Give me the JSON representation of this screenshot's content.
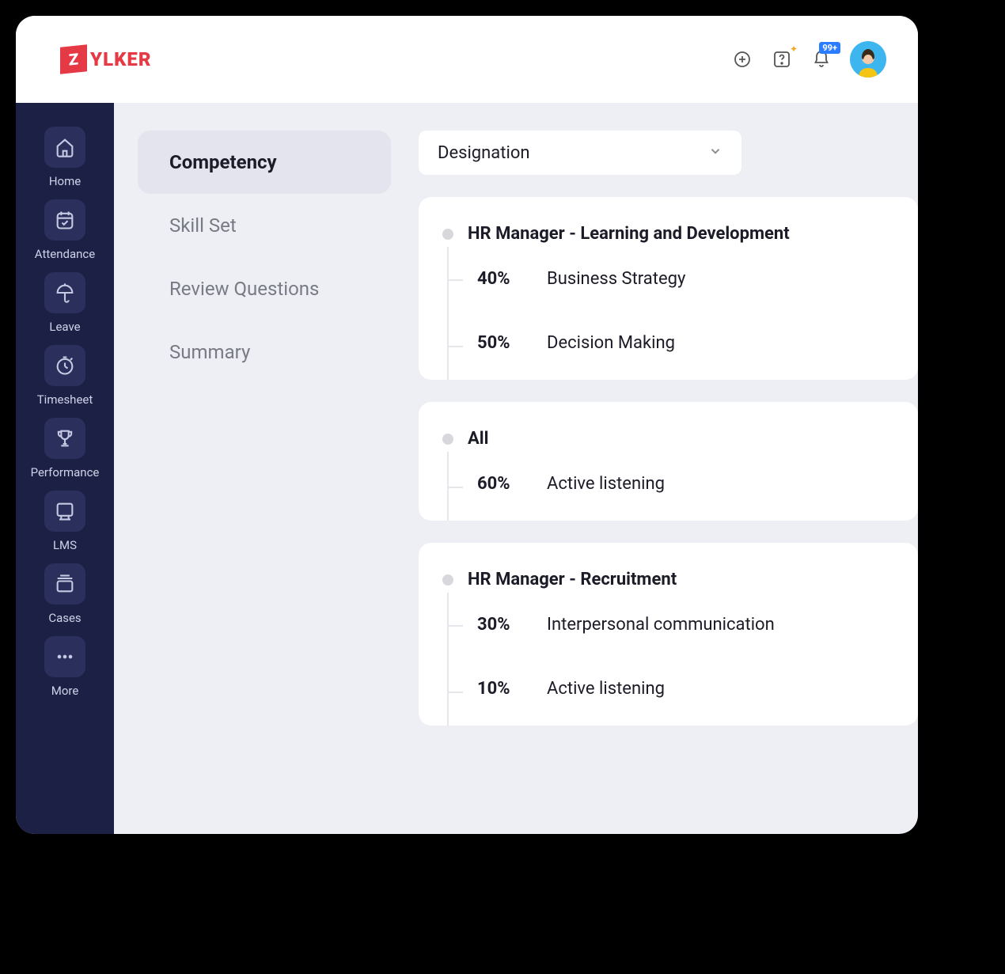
{
  "logo": {
    "badge": "Z",
    "text": "YLKER"
  },
  "header": {
    "notification_badge": "99+"
  },
  "sidebar": {
    "items": [
      {
        "label": "Home"
      },
      {
        "label": "Attendance"
      },
      {
        "label": "Leave"
      },
      {
        "label": "Timesheet"
      },
      {
        "label": "Performance"
      },
      {
        "label": "LMS"
      },
      {
        "label": "Cases"
      },
      {
        "label": "More"
      }
    ]
  },
  "tabs": [
    {
      "label": "Competency"
    },
    {
      "label": "Skill Set"
    },
    {
      "label": "Review Questions"
    },
    {
      "label": "Summary"
    }
  ],
  "dropdown": {
    "label": "Designation"
  },
  "cards": [
    {
      "title": "HR Manager - Learning and Development",
      "items": [
        {
          "pct": "40%",
          "label": "Business Strategy"
        },
        {
          "pct": "50%",
          "label": "Decision Making"
        }
      ]
    },
    {
      "title": "All",
      "items": [
        {
          "pct": "60%",
          "label": "Active listening"
        }
      ]
    },
    {
      "title": "HR Manager - Recruitment",
      "items": [
        {
          "pct": "30%",
          "label": "Interpersonal communication"
        },
        {
          "pct": "10%",
          "label": "Active listening"
        }
      ]
    }
  ]
}
